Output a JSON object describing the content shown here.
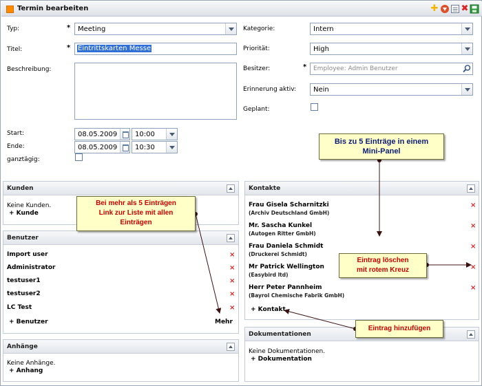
{
  "window": {
    "title": "Termin bearbeiten",
    "icons": [
      "add-icon",
      "down-arrow-icon",
      "list-icon",
      "close-red-icon",
      "save-green-icon"
    ]
  },
  "form": {
    "typ": {
      "label": "Typ:",
      "value": "Meeting"
    },
    "titel": {
      "label": "Titel:",
      "value": "Eintrittskarten Messe"
    },
    "beschreibung": {
      "label": "Beschreibung:"
    },
    "start": {
      "label": "Start:",
      "date": "08.05.2009",
      "time": "10:00"
    },
    "ende": {
      "label": "Ende:",
      "date": "08.05.2009",
      "time": "10:30"
    },
    "ganztaegig": {
      "label": "ganztägig:"
    },
    "kategorie": {
      "label": "Kategorie:",
      "value": "Intern"
    },
    "prioritaet": {
      "label": "Priorität:",
      "value": "High"
    },
    "besitzer": {
      "label": "Besitzer:",
      "placeholder": "Employee: Admin Benutzer"
    },
    "erinnerung": {
      "label": "Erinnerung aktiv:",
      "value": "Nein"
    },
    "geplant": {
      "label": "Geplant:"
    },
    "required_mark": "*"
  },
  "panels": {
    "kunden": {
      "title": "Kunden",
      "empty": "Keine Kunden.",
      "add": "+ Kunde"
    },
    "benutzer": {
      "title": "Benutzer",
      "items": [
        "Import user",
        "Administrator",
        "testuser1",
        "testuser2",
        "LC Test"
      ],
      "add": "+ Benutzer",
      "more": "Mehr"
    },
    "anhaenge": {
      "title": "Anhänge",
      "empty": "Keine Anhänge.",
      "add": "+ Anhang"
    },
    "kontakte": {
      "title": "Kontakte",
      "items": [
        {
          "name": "Frau Gisela Scharnitzki",
          "company": "(Archiv Deutschland GmbH)"
        },
        {
          "name": "Mr. Sascha Kunkel",
          "company": "(Autogen Ritter GmbH)"
        },
        {
          "name": "Frau Daniela Schmidt",
          "company": "(Druckerei Schmidt)"
        },
        {
          "name": "Mr Patrick Wellington",
          "company": "(Easybird ltd)"
        },
        {
          "name": "Herr Peter Pannheim",
          "company": "(Bayrol Chemische Fabrik GmbH)"
        }
      ],
      "add": "+ Kontakt"
    },
    "dokumentationen": {
      "title": "Dokumentationen",
      "empty": "Keine Dokumentationen.",
      "add": "+ Dokumentation"
    }
  },
  "delete_mark": "×",
  "callouts": {
    "mini_panel": [
      "Bis zu 5 Einträge in einem",
      "Mini-Panel"
    ],
    "more_link": [
      "Bei mehr als 5 Einträgen",
      "Link zur Liste mit allen",
      "Einträgen"
    ],
    "delete": [
      "Eintrag löschen",
      "mit rotem Kreuz"
    ],
    "add": "Eintrag hinzufügen"
  }
}
